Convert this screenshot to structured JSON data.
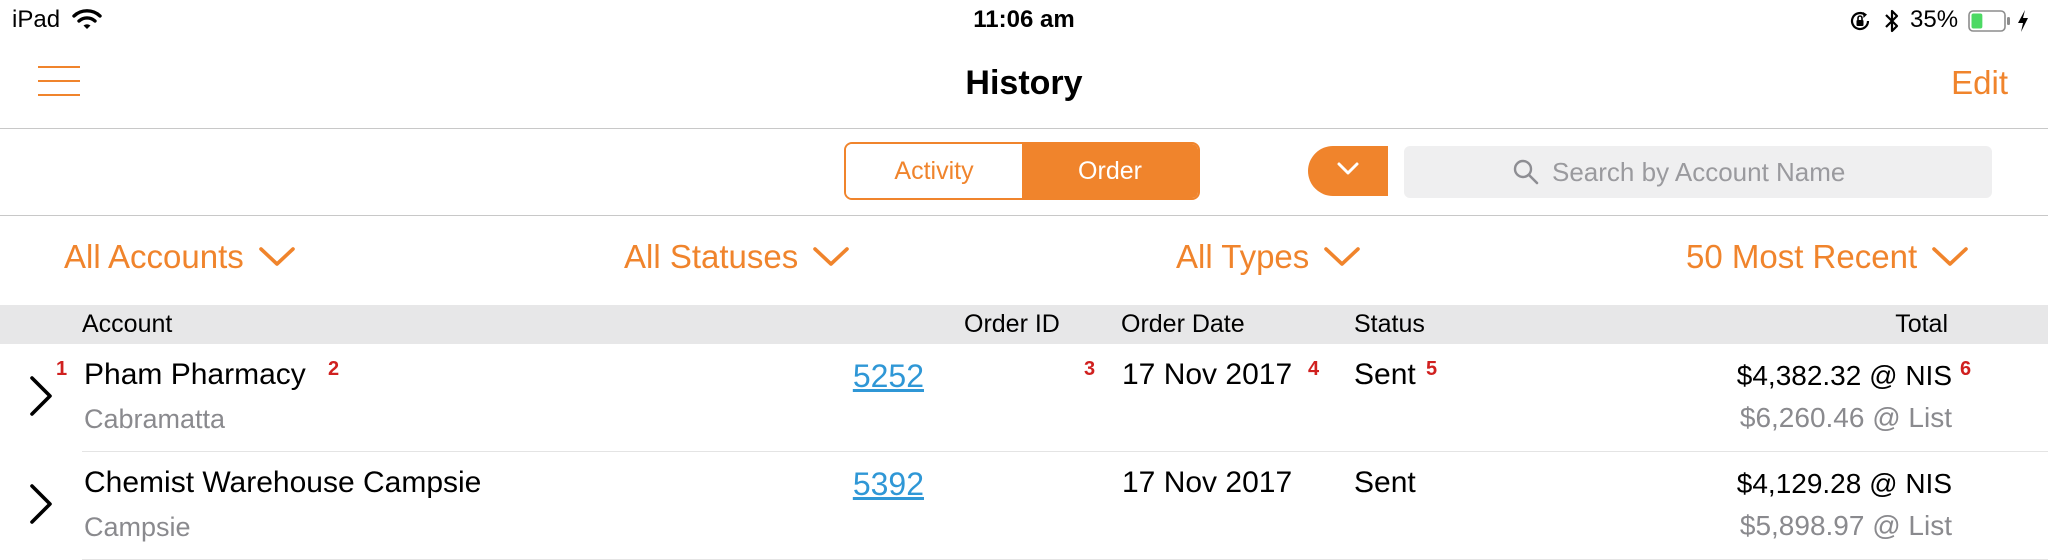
{
  "status_bar": {
    "device": "iPad",
    "time": "11:06 am",
    "battery_percent": "35%",
    "battery_level": 0.35
  },
  "nav": {
    "title": "History",
    "edit_label": "Edit"
  },
  "segments": {
    "activity_label": "Activity",
    "order_label": "Order",
    "selected": "Order"
  },
  "search": {
    "placeholder": "Search by Account Name",
    "value": ""
  },
  "filters": {
    "accounts": "All Accounts",
    "statuses": "All Statuses",
    "types": "All Types",
    "recent": "50 Most Recent"
  },
  "table": {
    "headers": {
      "account": "Account",
      "order_id": "Order ID",
      "order_date": "Order Date",
      "status": "Status",
      "total": "Total"
    },
    "rows": [
      {
        "account": "Pham Pharmacy",
        "suburb": "Cabramatta",
        "order_id": "5252",
        "order_date": "17 Nov 2017",
        "status": "Sent",
        "total_main": "$4,382.32 @ NIS",
        "total_list": "$6,260.46 @ List"
      },
      {
        "account": "Chemist Warehouse Campsie",
        "suburb": "Campsie",
        "order_id": "5392",
        "order_date": "17 Nov 2017",
        "status": "Sent",
        "total_main": "$4,129.28 @ NIS",
        "total_list": "$5,898.97 @ List"
      }
    ]
  },
  "annotations": {
    "m1": "1",
    "m2": "2",
    "m3": "3",
    "m4": "4",
    "m5": "5",
    "m6": "6"
  },
  "colors": {
    "accent": "#f0842c",
    "link": "#2f97d6",
    "marker": "#d0201f",
    "header_bg": "#e7e7e8"
  }
}
